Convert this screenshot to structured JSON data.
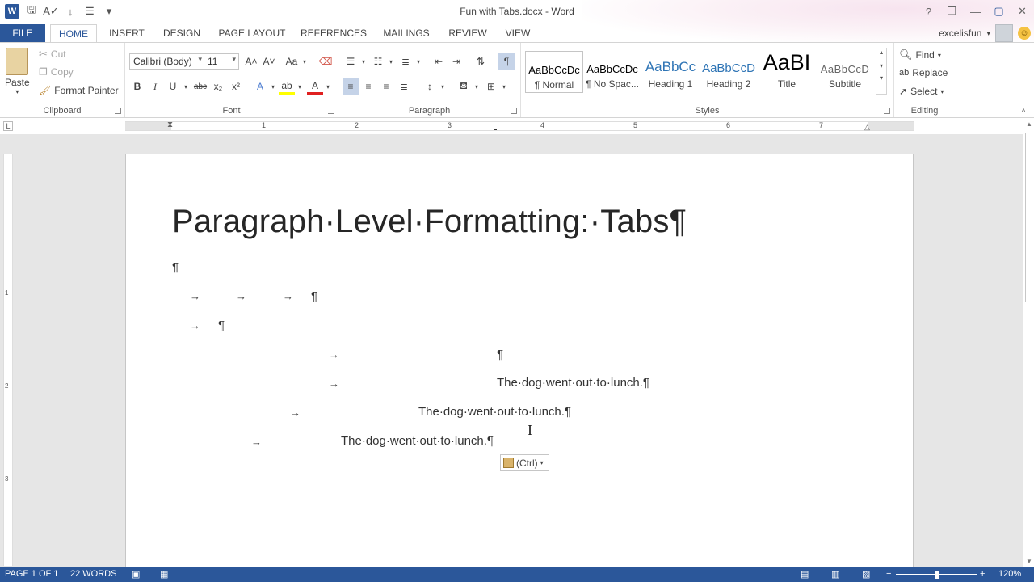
{
  "title_bar": {
    "document_title": "Fun with Tabs.docx - Word",
    "qat_icons": [
      "word-icon",
      "save-icon",
      "spelling-icon",
      "sort-icon",
      "bullet-list-icon",
      "customize-icon"
    ],
    "window_controls": [
      "?",
      "❐",
      "—",
      "▢",
      "✕"
    ]
  },
  "tabs": {
    "file": "FILE",
    "items": [
      "HOME",
      "INSERT",
      "DESIGN",
      "PAGE LAYOUT",
      "REFERENCES",
      "MAILINGS",
      "REVIEW",
      "VIEW"
    ],
    "active": "HOME",
    "account_name": "excelisfun"
  },
  "ribbon": {
    "clipboard": {
      "label": "Clipboard",
      "paste": "Paste",
      "cut": "Cut",
      "copy": "Copy",
      "format_painter": "Format Painter"
    },
    "font": {
      "label": "Font",
      "font_name": "Calibri (Body)",
      "font_size": "11",
      "bold": "B",
      "italic": "I",
      "underline": "U",
      "strikethrough": "abc",
      "subscript": "x₂",
      "superscript": "x²",
      "grow": "A˄",
      "shrink": "A˅",
      "case": "Aa",
      "effects": "A",
      "highlight": "ab",
      "font_color": "A"
    },
    "paragraph": {
      "label": "Paragraph",
      "show_marks": "¶"
    },
    "styles": {
      "label": "Styles",
      "items": [
        {
          "sample": "AaBbCcDc",
          "name": "¶ Normal"
        },
        {
          "sample": "AaBbCcDc",
          "name": "¶ No Spac..."
        },
        {
          "sample": "AaBbCc",
          "name": "Heading 1"
        },
        {
          "sample": "AaBbCcD",
          "name": "Heading 2"
        },
        {
          "sample": "AaBI",
          "name": "Title"
        },
        {
          "sample": "AaBbCcD",
          "name": "Subtitle"
        }
      ]
    },
    "editing": {
      "label": "Editing",
      "find": "Find",
      "replace": "Replace",
      "select": "Select"
    }
  },
  "ruler": {
    "corner": "L",
    "numbers": [
      "1",
      "2",
      "3",
      "4",
      "5",
      "6",
      "7"
    ]
  },
  "vertical_ruler": {
    "numbers": [
      "1",
      "2",
      "3"
    ]
  },
  "document": {
    "heading": "Paragraph·Level·Formatting:·Tabs¶",
    "pilcrow": "¶",
    "tab_arrow": "→",
    "line4": "The·dog·went·out·to·lunch.¶",
    "line5": "The·dog·went·out·to·lunch.¶",
    "line6": "The·dog·went·out·to·lunch.¶"
  },
  "paste_options": {
    "label": "(Ctrl)"
  },
  "status_bar": {
    "page": "PAGE 1 OF 1",
    "words": "22 WORDS",
    "zoom_minus": "−",
    "zoom_plus": "+",
    "zoom": "120%"
  },
  "colors": {
    "accent": "#2b579a",
    "status_bar": "#2b579a"
  }
}
